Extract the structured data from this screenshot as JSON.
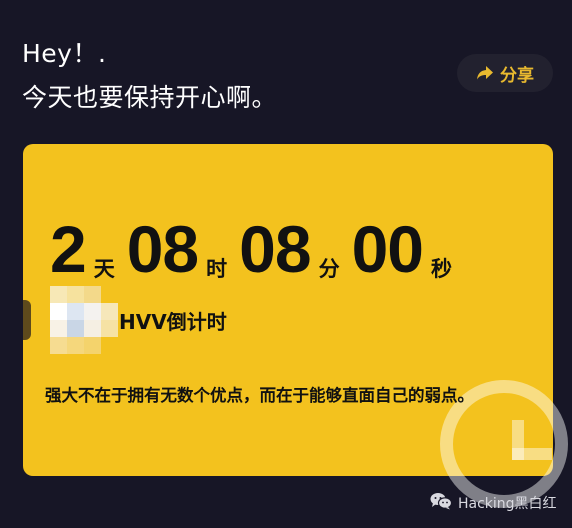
{
  "greeting": {
    "line1": "Hey！.",
    "line2": "今天也要保持开心啊。"
  },
  "share": {
    "label": "分享",
    "icon": "share-arrow-icon"
  },
  "countdown": {
    "days": "2",
    "days_unit": "天",
    "hours": "08",
    "hours_unit": "时",
    "minutes": "08",
    "minutes_unit": "分",
    "seconds": "00",
    "seconds_unit": "秒"
  },
  "event": {
    "title": "HVV倒计时",
    "icon": "blurred-logo-icon"
  },
  "quote": "强大不在于拥有无数个优点，而在于能够直面自己的弱点。",
  "watermark": {
    "label": "Hacking黑白红",
    "icon": "wechat-icon"
  },
  "colors": {
    "background": "#171626",
    "card": "#f3c21e",
    "accent": "#e8b92f",
    "text_dark": "#111111"
  }
}
